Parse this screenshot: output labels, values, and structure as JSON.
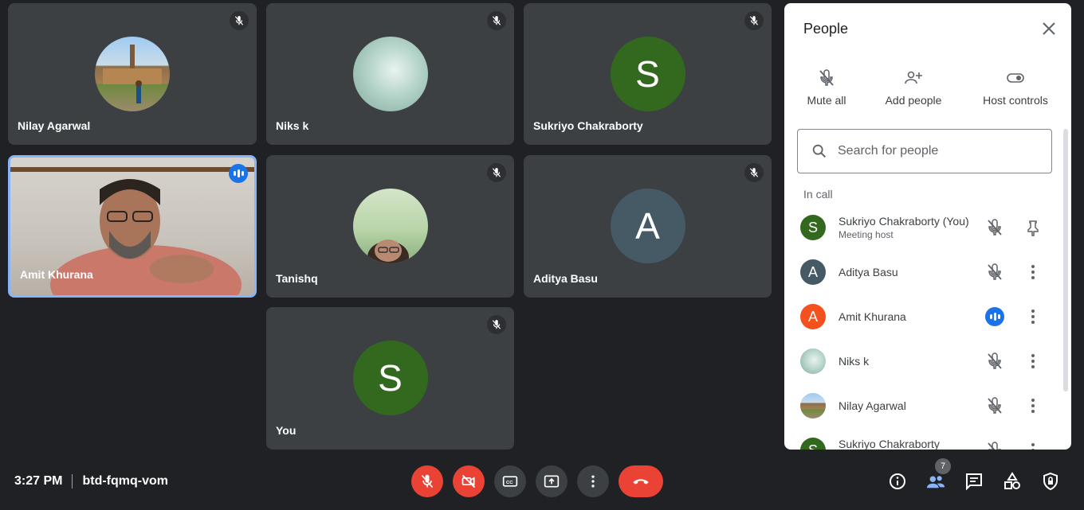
{
  "tiles": [
    {
      "name": "Nilay Agarwal",
      "muted": true
    },
    {
      "name": "Niks k",
      "muted": true
    },
    {
      "name": "Sukriyo Chakraborty",
      "initial": "S",
      "muted": true
    },
    {
      "name": "Amit Khurana",
      "speaking": true
    },
    {
      "name": "Tanishq",
      "muted": true
    },
    {
      "name": "Aditya Basu",
      "initial": "A",
      "muted": true
    },
    {
      "name": "You",
      "initial": "S",
      "muted": true
    }
  ],
  "panel": {
    "title": "People",
    "actions": {
      "mute_all": "Mute all",
      "add_people": "Add people",
      "host_controls": "Host controls"
    },
    "search_placeholder": "Search for people",
    "section": "In call",
    "people": [
      {
        "name": "Sukriyo Chakraborty (You)",
        "subtitle": "Meeting host",
        "initial": "S"
      },
      {
        "name": "Aditya Basu",
        "initial": "A"
      },
      {
        "name": "Amit Khurana",
        "initial": "A"
      },
      {
        "name": "Niks k"
      },
      {
        "name": "Nilay Agarwal"
      },
      {
        "name": "Sukriyo Chakraborty",
        "initial": "S"
      }
    ]
  },
  "bottom": {
    "time": "3:27 PM",
    "meeting_code": "btd-fqmq-vom",
    "people_count": "7"
  },
  "colors": {
    "green": "#33691e",
    "slate": "#455a64",
    "orange": "#f4511e",
    "red": "#ea4335",
    "blue": "#1a73e8"
  }
}
